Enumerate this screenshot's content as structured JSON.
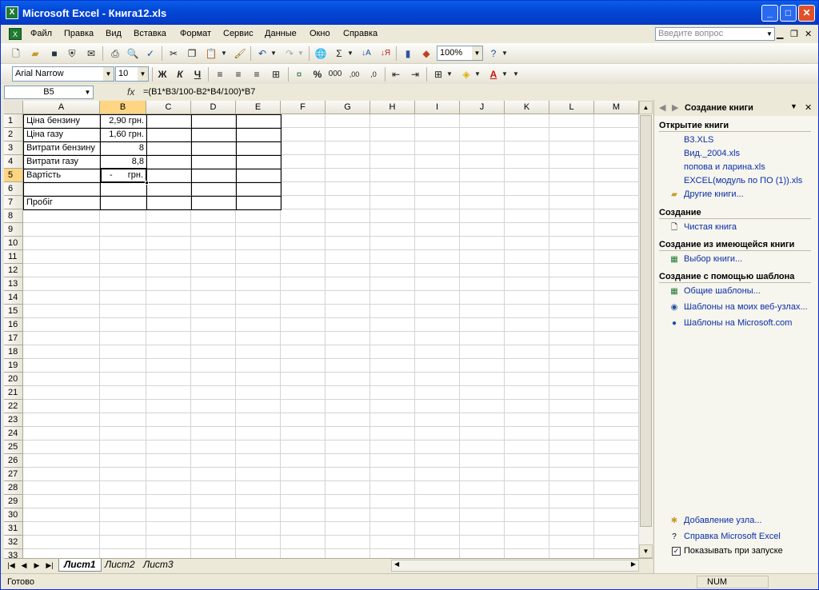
{
  "window": {
    "title": "Microsoft Excel - Книга12.xls",
    "min": "_",
    "max": "□",
    "close": "✕"
  },
  "menu": {
    "items": [
      "Файл",
      "Правка",
      "Вид",
      "Вставка",
      "Формат",
      "Сервис",
      "Данные",
      "Окно",
      "Справка"
    ],
    "ask_placeholder": "Введите вопрос",
    "win_min": "▁",
    "win_restore": "❐",
    "win_close": "✕"
  },
  "toolbar": {
    "zoom": "100%",
    "font": "Arial Narrow",
    "size": "10",
    "bold": "Ж",
    "italic": "К",
    "underline": "Ч",
    "sigma": "Σ",
    "percent": "%",
    "thousands": "000",
    "inc_dec": ",00",
    "dec_dec": ",0"
  },
  "formula_bar": {
    "name_box": "B5",
    "fx": "fx",
    "content": "=(B1*B3/100-B2*B4/100)*B7"
  },
  "columns": [
    "A",
    "B",
    "C",
    "D",
    "E",
    "F",
    "G",
    "H",
    "I",
    "J",
    "K",
    "L",
    "M"
  ],
  "rows": [
    "1",
    "2",
    "3",
    "4",
    "5",
    "6",
    "7",
    "8",
    "9",
    "10",
    "11",
    "12",
    "13",
    "14",
    "15",
    "16",
    "17",
    "18",
    "19",
    "20",
    "21",
    "22",
    "23",
    "24",
    "25",
    "26",
    "27",
    "28",
    "29",
    "30",
    "31",
    "32",
    "33"
  ],
  "cells": {
    "A1": "Ціна бензину",
    "B1": "2,90 грн.",
    "A2": "Ціна газу",
    "B2": "1,60 грн.",
    "A3": "Витрати бензину",
    "B3": "8",
    "A4": "Витрати газу",
    "B4": "8,8",
    "A5": "Вартість",
    "B5_dash": "-",
    "B5_cur": "грн.",
    "A7": "Пробіг"
  },
  "sheets": {
    "tab1": "Лист1",
    "tab2": "Лист2",
    "tab3": "Лист3"
  },
  "status": {
    "ready": "Готово",
    "num": "NUM"
  },
  "taskpane": {
    "title": "Создание книги",
    "open_section": "Открытие книги",
    "recent_files": [
      "B3.XLS",
      "Вид._2004.xls",
      "попова и ларина.xls",
      "EXCEL(модуль по ПО (1)).xls"
    ],
    "other_books": "Другие книги...",
    "create_section": "Создание",
    "blank": "Чистая книга",
    "from_existing_section": "Создание из имеющейся книги",
    "choose_book": "Выбор книги...",
    "template_section": "Создание с помощью шаблона",
    "general_templates": "Общие шаблоны...",
    "web_templates": "Шаблоны на моих веб-узлах...",
    "ms_templates": "Шаблоны на Microsoft.com",
    "add_node": "Добавление узла...",
    "help": "Справка Microsoft Excel",
    "show_at_startup": "Показывать при запуске"
  }
}
